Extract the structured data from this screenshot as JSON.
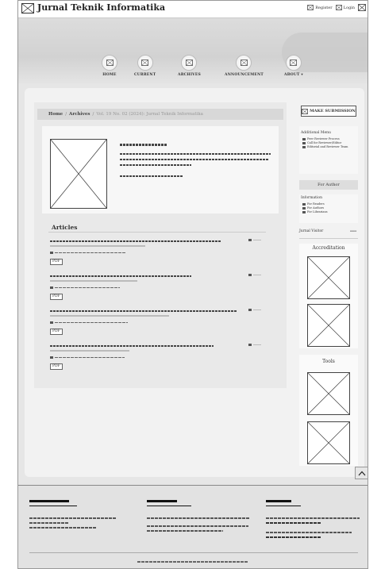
{
  "site": {
    "title": "Jurnal Teknik Informatika"
  },
  "topbar": {
    "register_label": "Register",
    "login_label": "Login"
  },
  "nav": {
    "items": [
      {
        "label": "HOME",
        "icon": "image-placeholder-icon"
      },
      {
        "label": "CURRENT",
        "icon": "image-placeholder-icon"
      },
      {
        "label": "ARCHIVES",
        "icon": "image-placeholder-icon"
      },
      {
        "label": "ANNOUNCEMENT",
        "icon": "image-placeholder-icon"
      },
      {
        "label": "ABOUT ▾",
        "icon": "image-placeholder-icon"
      }
    ]
  },
  "breadcrumb": {
    "home": "Home",
    "separator": "/",
    "archives": "Archives",
    "current": "Vol. 19 No. 02 (2024): Jurnal Teknik Informatika"
  },
  "articles": {
    "title": "Articles",
    "pdf_label": "PDF"
  },
  "sidebar": {
    "submit_label": "MAKE SUBMISSION",
    "additional_title": "Additional Menu",
    "additional_links": [
      "Peer Reviewer Process",
      "Call for Reviewer/Editor",
      "Editorial and Reviewer Team"
    ],
    "for_author": "For Author",
    "information_title": "Information",
    "information_links": [
      "For Readers",
      "For Authors",
      "For Librarians"
    ],
    "visitor_title": "Jurnal Visitor",
    "accreditation_title": "Accreditation",
    "tools_title": "Tools"
  },
  "colors": {
    "page_background": "#e6e6e6",
    "panel": "#f2f2f2",
    "footer": "#e2e2e2"
  }
}
